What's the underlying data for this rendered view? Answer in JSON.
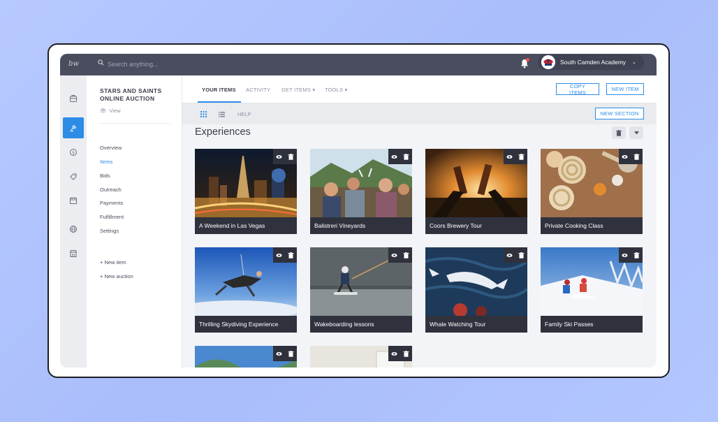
{
  "topbar": {
    "logo": "bw",
    "search_placeholder": "Search anything...",
    "org_name": "South Camden Academy",
    "org_chevron": "⌄"
  },
  "rail": {
    "icons": [
      "dashboard-icon",
      "auction-gavel-icon",
      "donation-icon",
      "tag-icon",
      "calendar-icon",
      "globe-icon",
      "store-icon"
    ],
    "active_index": 1
  },
  "leftnav": {
    "auction_title": "STARS AND SAINTS ONLINE AUCTION",
    "view_label": "View",
    "items": [
      "Overview",
      "Items",
      "Bids",
      "Outreach",
      "Payments",
      "Fulfillment",
      "Settings"
    ],
    "active_item": "Items",
    "add_links": [
      "+ New item",
      "+ New auction"
    ]
  },
  "tabs": {
    "your_items": "YOUR ITEMS",
    "activity": "ACTIVITY",
    "get_items": "GET ITEMS ▾",
    "tools": "TOOLS ▾"
  },
  "actions": {
    "copy_items": "COPY ITEMS",
    "new_item": "NEW ITEM",
    "new_section": "NEW SECTION"
  },
  "subbar": {
    "help": "HELP"
  },
  "section": {
    "title": "Experiences",
    "items": [
      "A Weekend in Las Vegas",
      "Balistreri Vineyards",
      "Coors Brewery Tour",
      "Private Cooking Class",
      "Thrilling Skydiving Experience",
      "Wakeboarding lessons",
      "Whale Watching Tour",
      "Family Ski Passes",
      "",
      ""
    ]
  },
  "colors": {
    "accent": "#2c8ce6",
    "topbar": "#4a4d5e",
    "card_caption": "#2f323d"
  }
}
